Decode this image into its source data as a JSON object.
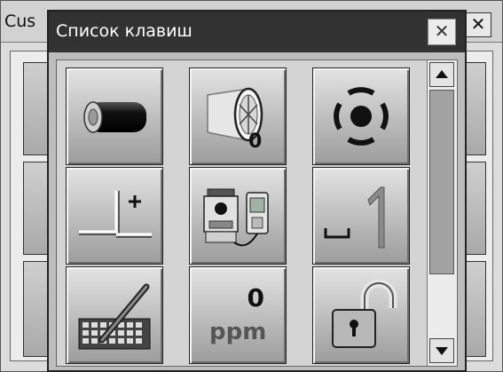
{
  "background_window": {
    "title": "Cus",
    "close_label": "✕"
  },
  "dialog": {
    "title": "Список клавиш",
    "close_label": "✕",
    "keys": [
      {
        "name": "battery-key",
        "icon": "battery-icon"
      },
      {
        "name": "prism-constant-key",
        "icon": "prism-lens-icon",
        "value": "0"
      },
      {
        "name": "laser-target-key",
        "icon": "laser-target-icon"
      },
      {
        "name": "tilt-correction-key",
        "icon": "plumb-offset-icon"
      },
      {
        "name": "instrument-link-key",
        "icon": "total-station-icon"
      },
      {
        "name": "space-one-key",
        "icon": "space-one-icon"
      },
      {
        "name": "keyboard-key",
        "icon": "keyboard-pen-icon"
      },
      {
        "name": "ppm-key",
        "icon": "ppm-icon",
        "value": "0",
        "unit": "ppm"
      },
      {
        "name": "unlock-key",
        "icon": "unlocked-padlock-icon"
      }
    ],
    "scrollbar": {
      "up_icon": "arrow-up-icon",
      "down_icon": "arrow-down-icon",
      "position": 0.0
    }
  }
}
